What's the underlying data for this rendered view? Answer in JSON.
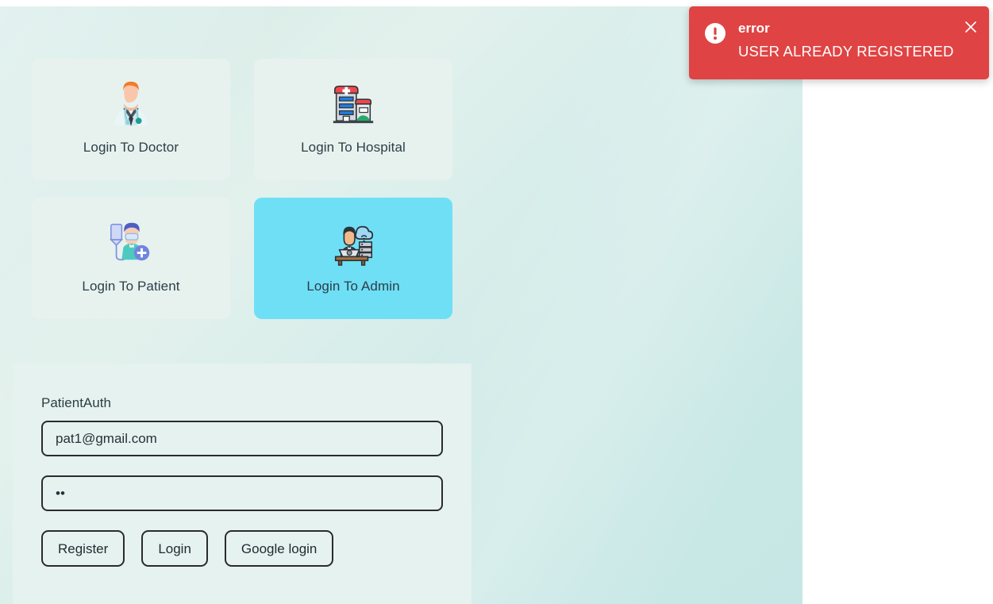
{
  "roles": {
    "cards": [
      {
        "label": "Login To Doctor",
        "icon": "doctor-avatar-icon",
        "selected": false
      },
      {
        "label": "Login To Hospital",
        "icon": "hospital-building-icon",
        "selected": false
      },
      {
        "label": "Login To Patient",
        "icon": "patient-nurse-icon",
        "selected": false
      },
      {
        "label": "Login To Admin",
        "icon": "admin-desk-server-icon",
        "selected": true
      }
    ]
  },
  "auth": {
    "title": "PatientAuth",
    "email": {
      "value": "pat1@gmail.com",
      "placeholder": ""
    },
    "password": {
      "value": "..",
      "masked_value": "••",
      "placeholder": ""
    },
    "buttons": {
      "register": "Register",
      "login": "Login",
      "google_login": "Google login"
    }
  },
  "toast": {
    "title": "error",
    "message": "USER ALREADY REGISTERED",
    "close_label": "×",
    "background": "#e04343",
    "text_color": "#ffffff"
  },
  "theme": {
    "page_background": "#d9eeeb",
    "card_background": "#e7f2ef",
    "selected_card_background": "#6fdff6",
    "text_color": "#2c3e46",
    "border_color": "#2b2b2b"
  }
}
